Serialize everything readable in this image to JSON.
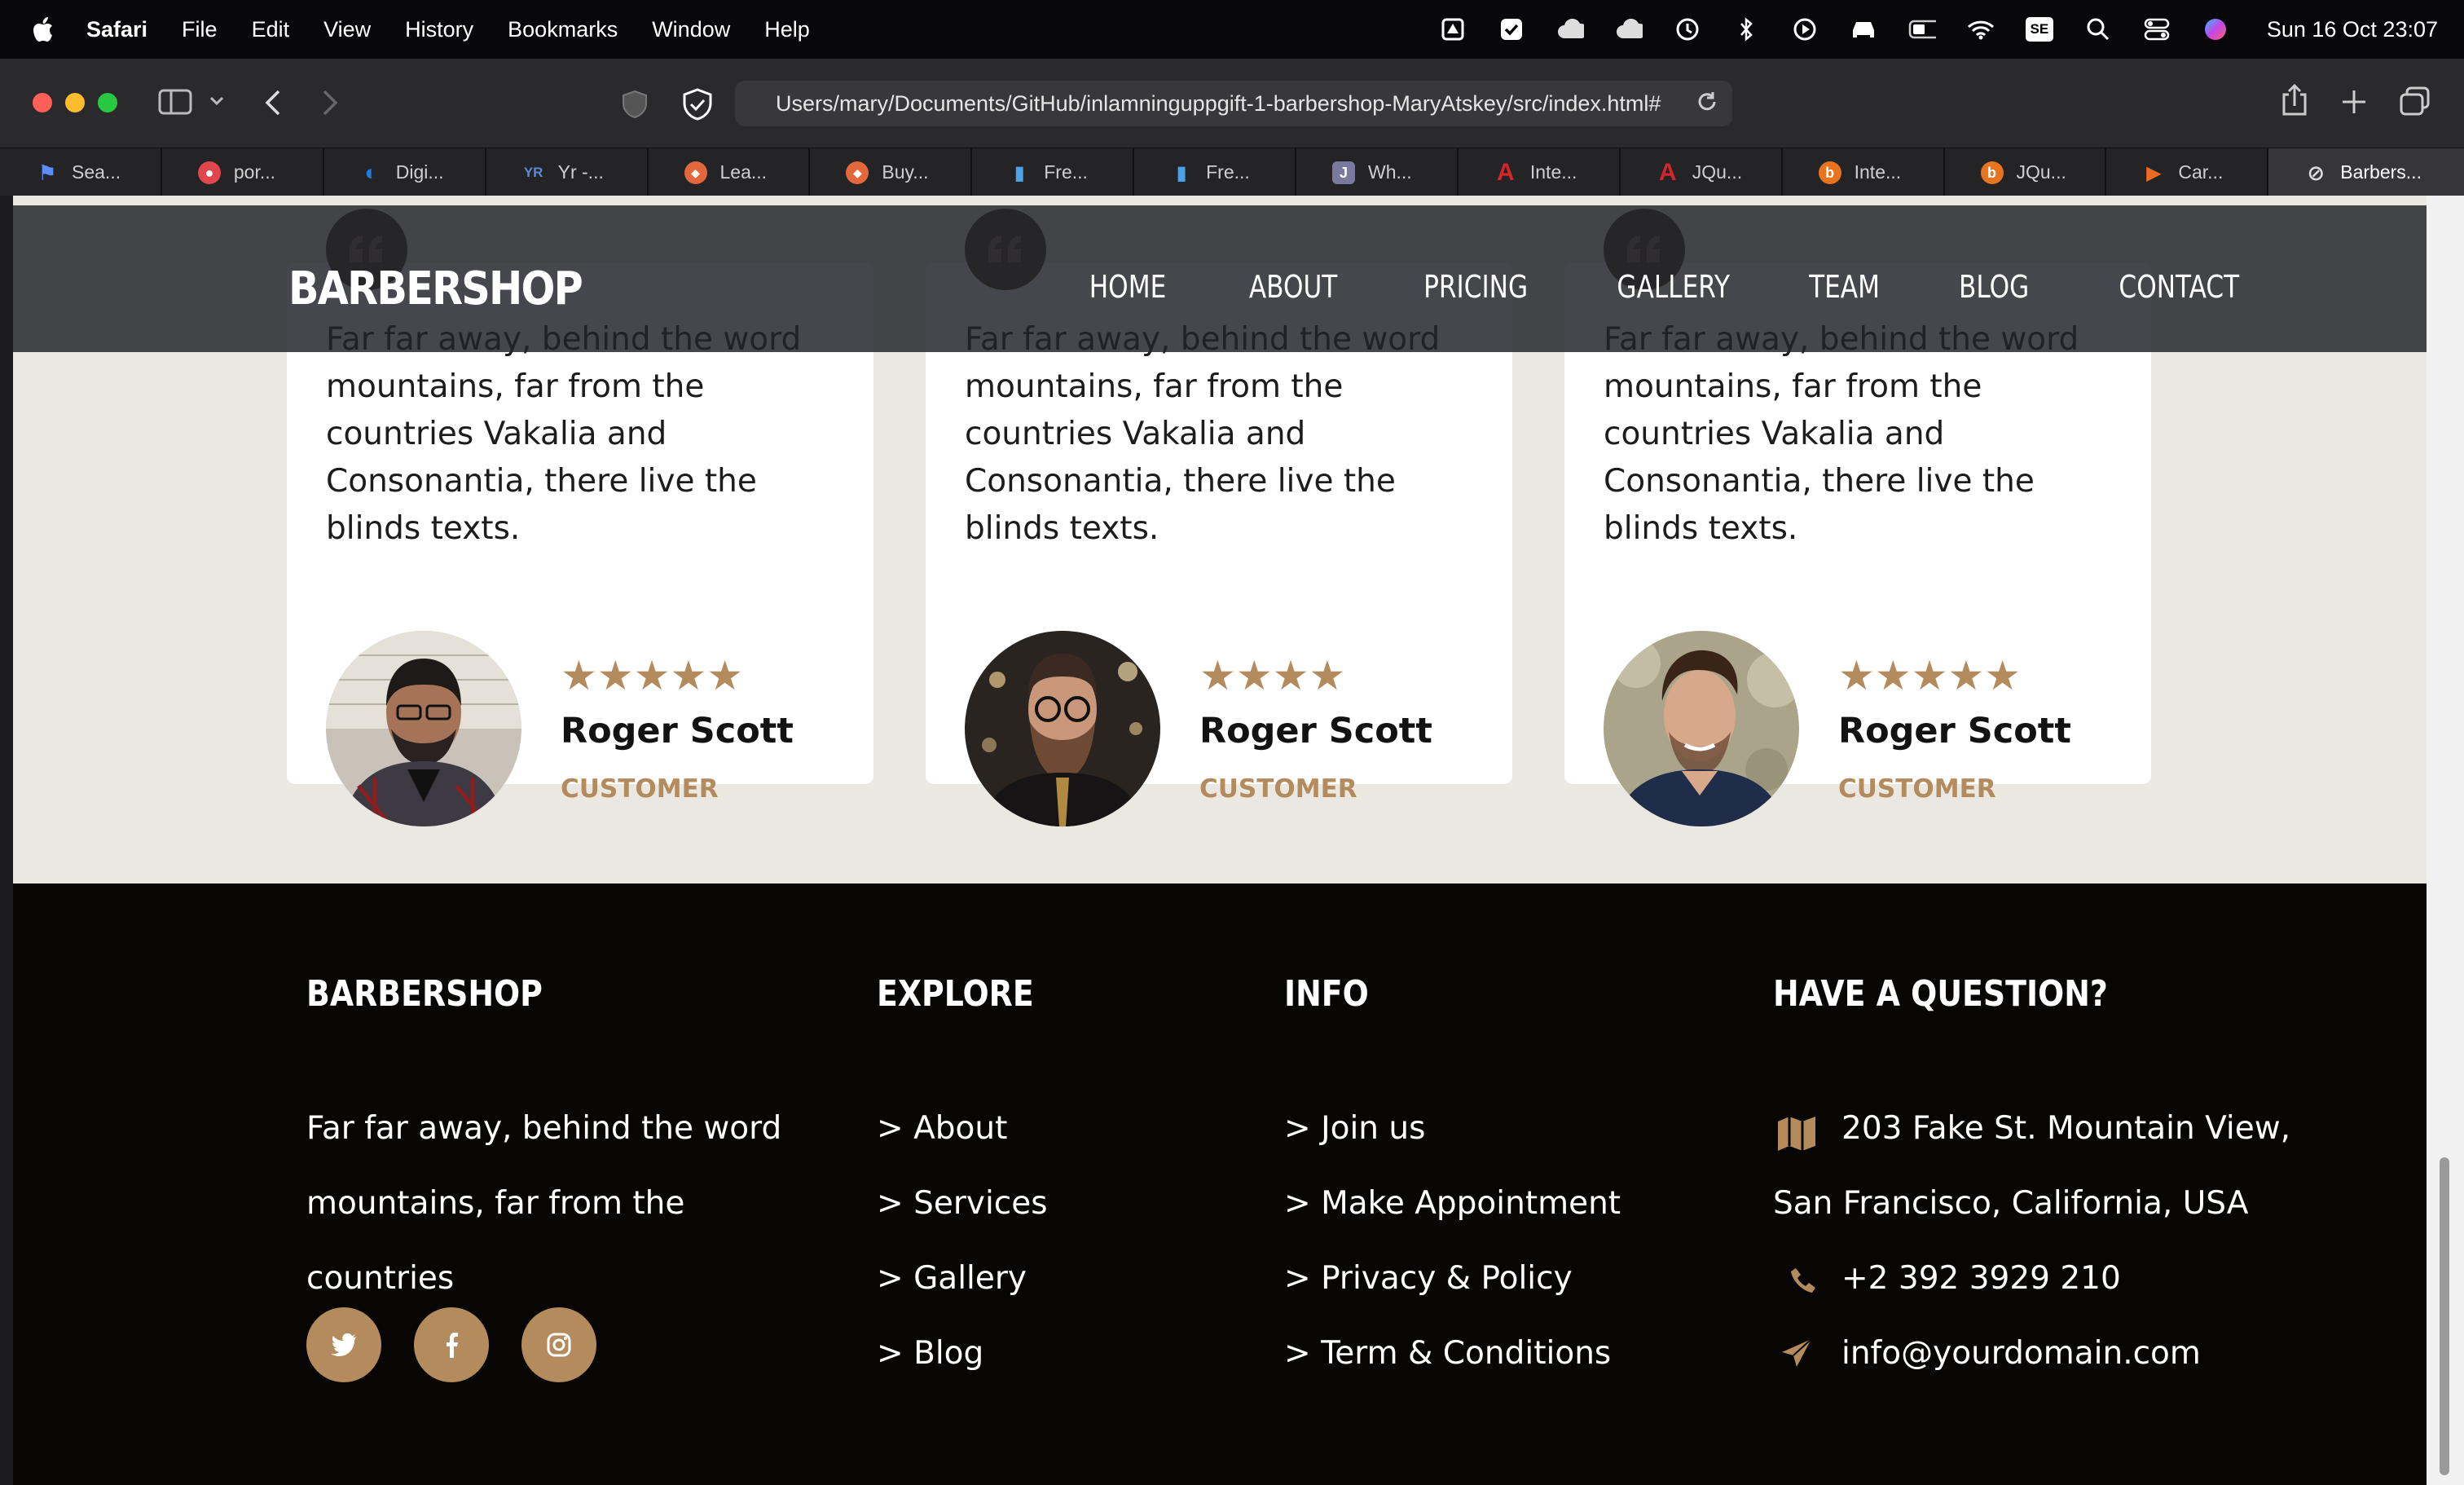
{
  "menubar": {
    "app": "Safari",
    "items": [
      "File",
      "Edit",
      "View",
      "History",
      "Bookmarks",
      "Window",
      "Help"
    ],
    "clock": "Sun 16 Oct  23:07",
    "se_label": "SE"
  },
  "toolbar": {
    "url": "Users/mary/Documents/GitHub/inlamninguppgift-1-barbershop-MaryAtskey/src/index.html#"
  },
  "tabs": [
    {
      "label": "Sea...",
      "color": "#2f5fd0",
      "glyph": "⚑"
    },
    {
      "label": "por...",
      "color": "#e0464b",
      "glyph": "●"
    },
    {
      "label": "Digi...",
      "color": "#1e7be0",
      "glyph": "◐"
    },
    {
      "label": "Yr -...",
      "color": "#1f3b74",
      "glyph": "YR"
    },
    {
      "label": "Lea...",
      "color": "#e2673c",
      "glyph": "◆"
    },
    {
      "label": "Buy...",
      "color": "#e2673c",
      "glyph": "◆"
    },
    {
      "label": "Fre...",
      "color": "#2d6fb3",
      "glyph": "▮"
    },
    {
      "label": "Fre...",
      "color": "#2d6fb3",
      "glyph": "▮"
    },
    {
      "label": "Wh...",
      "color": "#7a7aa0",
      "glyph": "J"
    },
    {
      "label": "Inte...",
      "color": "#d2262b",
      "glyph": "A"
    },
    {
      "label": "JQu...",
      "color": "#d2262b",
      "glyph": "A"
    },
    {
      "label": "Inte...",
      "color": "#e8741f",
      "glyph": "b"
    },
    {
      "label": "JQu...",
      "color": "#e8741f",
      "glyph": "b"
    },
    {
      "label": "Car...",
      "color": "#f06a22",
      "glyph": "▶"
    },
    {
      "label": "Barbers...",
      "color": "#5a5a5e",
      "glyph": "⊘"
    }
  ],
  "site": {
    "brand": "BARBERSHOP",
    "nav": [
      "HOME",
      "ABOUT",
      "PRICING",
      "GALLERY",
      "TEAM",
      "BLOG",
      "CONTACT"
    ]
  },
  "testimonials": [
    {
      "text": "Far far away, behind the word mountains, far from the countries Vakalia and Consonantia, there live the blinds texts.",
      "stars": "★★★★★",
      "rating": 5,
      "name": "Roger Scott",
      "role": "CUSTOMER"
    },
    {
      "text": "Far far away, behind the word mountains, far from the countries Vakalia and Consonantia, there live the blinds texts.",
      "stars": "★★★★",
      "rating": 4,
      "name": "Roger Scott",
      "role": "CUSTOMER"
    },
    {
      "text": "Far far away, behind the word mountains, far from the countries Vakalia and Consonantia, there live the blinds texts.",
      "stars": "★★★★★",
      "rating": 5,
      "name": "Roger Scott",
      "role": "CUSTOMER"
    }
  ],
  "footer": {
    "col1": {
      "heading": "BARBERSHOP",
      "lines": [
        "Far far away, behind the word",
        "mountains, far from the",
        "countries"
      ]
    },
    "col2": {
      "heading": "EXPLORE",
      "links": [
        "> About",
        "> Services",
        "> Gallery",
        "> Blog"
      ]
    },
    "col3": {
      "heading": "INFO",
      "links": [
        "> Join us",
        "> Make Appointment",
        "> Privacy & Policy",
        "> Term & Conditions"
      ]
    },
    "col4": {
      "heading": "HAVE A QUESTION?",
      "address_line1": "203 Fake St. Mountain View,",
      "address_line2": "San Francisco, California, USA",
      "phone": "+2 392 3929 210",
      "email": "info@yourdomain.com"
    },
    "accent": "#b38b5d"
  }
}
